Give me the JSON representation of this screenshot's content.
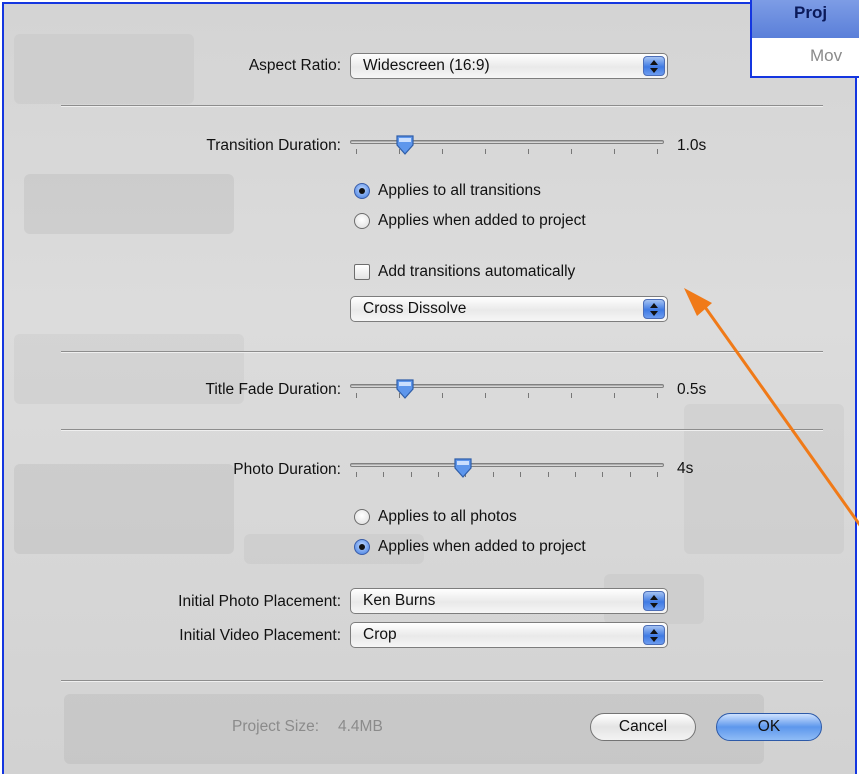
{
  "inset": {
    "line1": "Proj",
    "line2": "Mov"
  },
  "aspect_ratio": {
    "label": "Aspect Ratio:",
    "value": "Widescreen (16:9)"
  },
  "transition_duration": {
    "label": "Transition Duration:",
    "value_text": "1.0s",
    "slider_fraction": 0.15,
    "applies_all": "Applies to all transitions",
    "applies_added": "Applies when added to project",
    "selected_option": "applies_all",
    "auto_add_label": "Add transitions automatically",
    "auto_add_checked": false,
    "transition_type": "Cross Dissolve"
  },
  "title_fade": {
    "label": "Title Fade Duration:",
    "value_text": "0.5s",
    "slider_fraction": 0.15
  },
  "photo_duration": {
    "label": "Photo Duration:",
    "value_text": "4s",
    "slider_fraction": 0.35,
    "applies_all": "Applies to all photos",
    "applies_added": "Applies when added to project",
    "selected_option": "applies_added"
  },
  "initial_photo_placement": {
    "label": "Initial Photo Placement:",
    "value": "Ken Burns"
  },
  "initial_video_placement": {
    "label": "Initial Video Placement:",
    "value": "Crop"
  },
  "project_size": {
    "label": "Project Size:",
    "value": "4.4MB"
  },
  "buttons": {
    "cancel": "Cancel",
    "ok": "OK"
  },
  "colors": {
    "frame": "#1436e0",
    "annotation_arrow": "#f07a18",
    "accent": "#3b78e0"
  }
}
